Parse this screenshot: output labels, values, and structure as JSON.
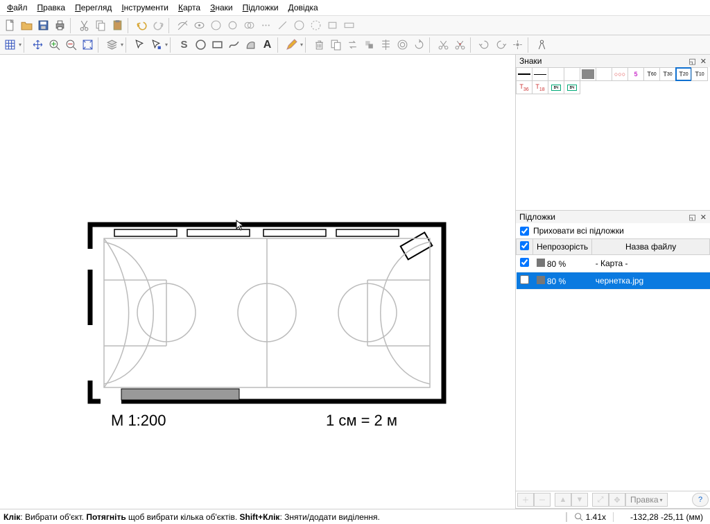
{
  "menu": [
    "Файл",
    "Правка",
    "Перегляд",
    "Інструменти",
    "Карта",
    "Знаки",
    "Підложки",
    "Довідка"
  ],
  "menuAccel": [
    0,
    0,
    0,
    0,
    0,
    0,
    0,
    0
  ],
  "panels": {
    "symbols": {
      "title": "Знаки"
    },
    "templates": {
      "title": "Підложки",
      "hideAll": "Приховати всі підложки",
      "cols": [
        "",
        "Непрозорість",
        "Назва файлу"
      ],
      "rows": [
        {
          "checked": true,
          "opacity": "80 %",
          "name": "- Карта -",
          "sel": false
        },
        {
          "checked": false,
          "opacity": "80 %",
          "name": "чернетка.jpg",
          "sel": true
        }
      ],
      "editLabel": "Правка"
    }
  },
  "canvas": {
    "scaleLeft": "М 1:200",
    "scaleRight": "1 см = 2 м"
  },
  "status": {
    "hint_bold1": "Клік",
    "hint_t1": ": Вибрати об'єкт. ",
    "hint_bold2": "Потягніть",
    "hint_t2": " щоб вибрати кілька об'єктів. ",
    "hint_bold3": "Shift+Клік",
    "hint_t3": ": Зняти/додати виділення.",
    "zoom": "1.41x",
    "coords": "-132,28 -25,11 (мм)"
  },
  "symbols": [
    {
      "html": "<div style='width:18px;border-top:2px solid #000'></div>",
      "name": "line-thick"
    },
    {
      "html": "<div style='width:18px;border-top:1px solid #000'></div>",
      "name": "line-thin"
    },
    {
      "html": "",
      "name": "empty1"
    },
    {
      "html": "",
      "name": "empty2"
    },
    {
      "html": "<div style='width:18px;height:14px;background:#888'></div>",
      "name": "fill-gray"
    },
    {
      "html": "",
      "name": "empty3"
    },
    {
      "html": "<span style='color:#d33;font-size:9px'>○○○</span>",
      "name": "dots-red"
    },
    {
      "html": "<span style='color:#c3c;font-weight:bold'>5</span>",
      "name": "num5"
    },
    {
      "html": "T<sub style='font-size:7px'>60</sub>",
      "name": "t60"
    },
    {
      "html": "T<sub style='font-size:7px'>30</sub>",
      "name": "t30"
    },
    {
      "html": "T<sub style='font-size:7px'>20</sub>",
      "name": "t20",
      "sel": true
    },
    {
      "html": "T<sub style='font-size:7px'>10</sub>",
      "name": "t10"
    },
    {
      "html": "<span style='color:#c33'>T<sub style='font-size:7px'>36</sub></span>",
      "name": "t36"
    },
    {
      "html": "<span style='color:#c33'>T<sub style='font-size:7px'>18</sub></span>",
      "name": "t18"
    },
    {
      "html": "<span style='border:1px solid #0a7;padding:0 2px;font-size:7px'>вч</span>",
      "name": "vch1"
    },
    {
      "html": "<span style='border:1px solid #0a7;padding:0 2px;font-size:7px'>вч</span>",
      "name": "vch2"
    }
  ]
}
